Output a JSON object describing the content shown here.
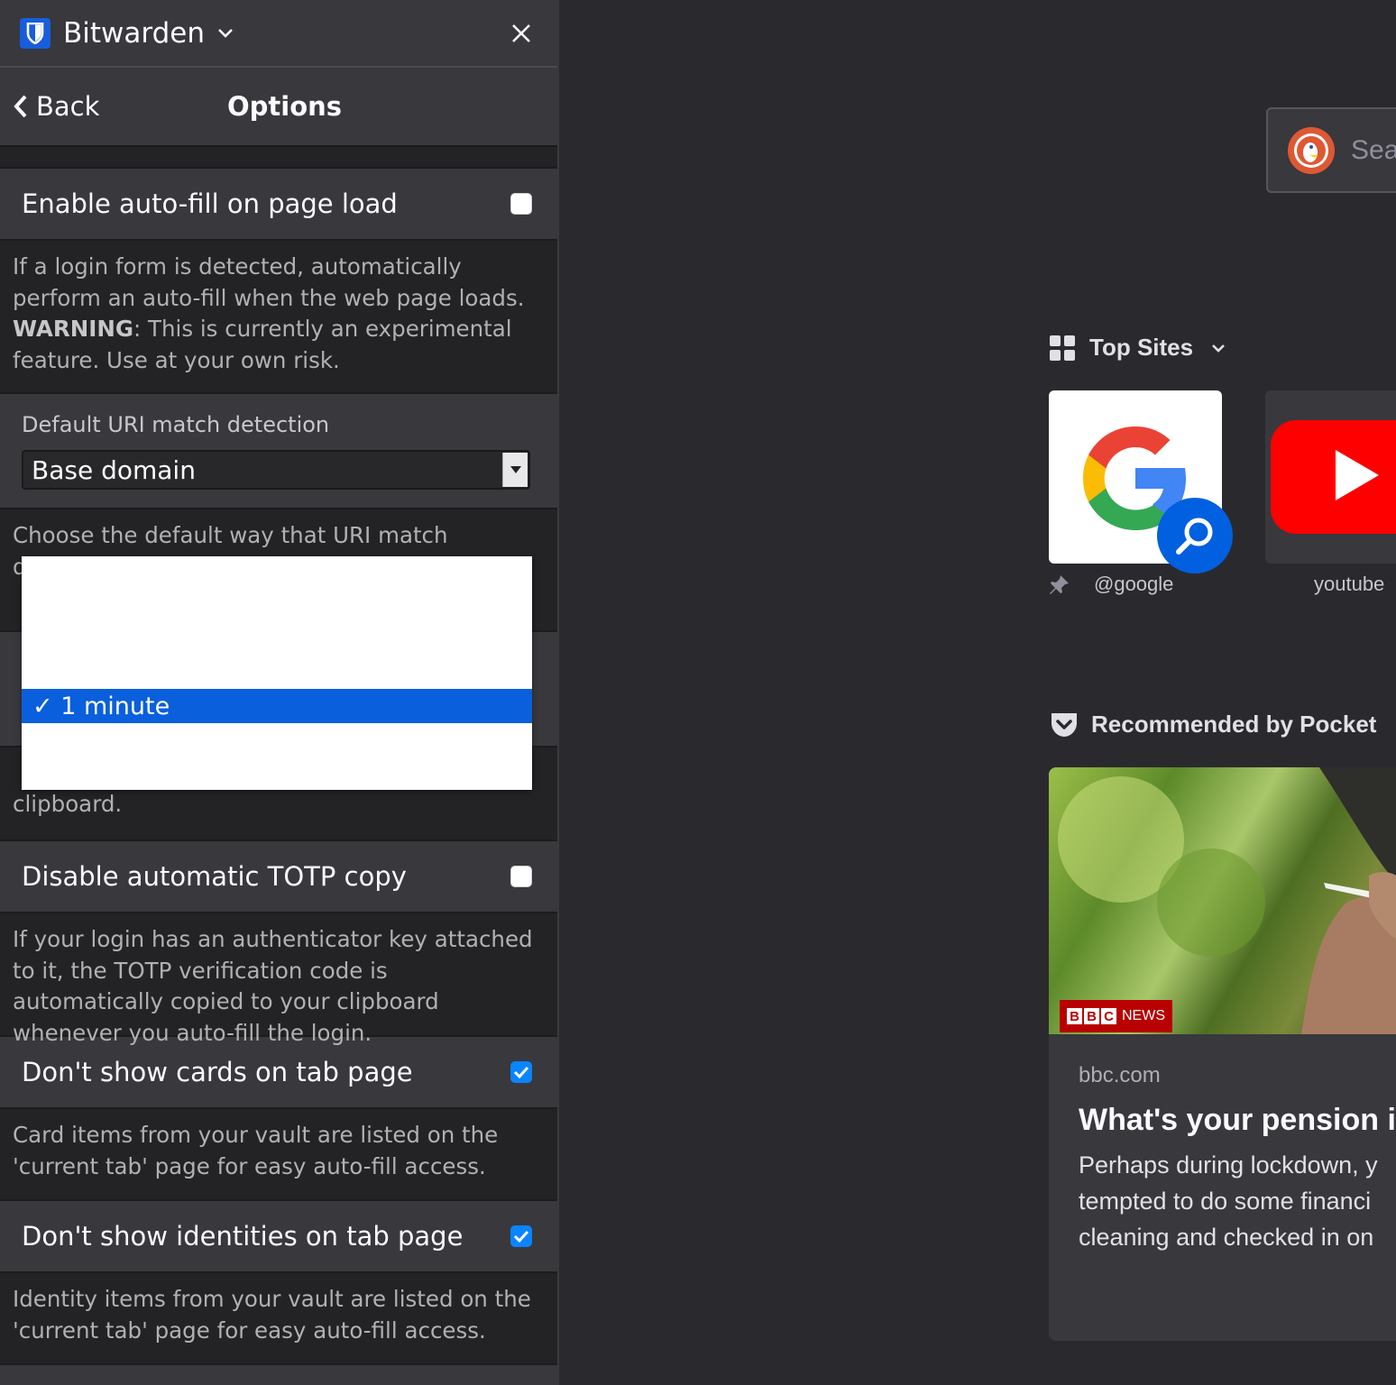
{
  "sidebar": {
    "app_title": "Bitwarden",
    "back_label": "Back",
    "page_title": "Options"
  },
  "options": {
    "autofill_on_load": {
      "label": "Enable auto-fill on page load",
      "checked": false,
      "help_before": "If a login form is detected, automatically perform an auto-fill when the web page loads. ",
      "help_warning": "WARNING",
      "help_after": ": This is currently an experimental feature. Use at your own risk."
    },
    "uri_match": {
      "label": "Default URI match detection",
      "value": "Base domain",
      "help": "Choose the default way that URI match detection is"
    },
    "clipboard_help_tail": "clipboard.",
    "disable_totp": {
      "label": "Disable automatic TOTP copy",
      "checked": false,
      "help": "If your login has an authenticator key attached to it, the TOTP verification code is automatically copied to your clipboard whenever you auto-fill the login."
    },
    "hide_cards": {
      "label": "Don't show cards on tab page",
      "checked": true,
      "help": "Card items from your vault are listed on the 'current tab' page for easy auto-fill access."
    },
    "hide_identities": {
      "label": "Don't show identities on tab page",
      "checked": true,
      "help": "Identity items from your vault are listed on the 'current tab' page for easy auto-fill access."
    }
  },
  "dropdown_popup": {
    "selected_option": "✓ 1 minute"
  },
  "newtab": {
    "search_placeholder": "Sea",
    "top_sites_label": "Top Sites",
    "top_sites": [
      {
        "label": "@google"
      },
      {
        "label": "youtube"
      }
    ],
    "pocket_label": "Recommended by Pocket",
    "story": {
      "source": "bbc.com",
      "title": "What's your pension i in?",
      "excerpt": "Perhaps during lockdown, y tempted to do some financi cleaning and checked in on",
      "badge_block_letters": [
        "B",
        "B",
        "C"
      ],
      "badge_word": "NEWS"
    }
  },
  "colors": {
    "accent": "#0a84ff",
    "popup_selection": "#0a5fdc",
    "bitwarden_brand": "#175ddc",
    "bbc_red": "#b80000"
  }
}
